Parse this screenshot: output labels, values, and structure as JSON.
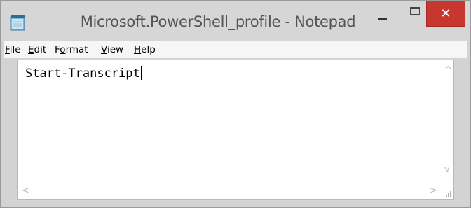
{
  "window": {
    "title": "Microsoft.PowerShell_profile - Notepad",
    "app_icon": "notepad-icon",
    "controls": {
      "minimize_icon": "minimize-icon",
      "maximize_icon": "maximize-icon",
      "close_glyph": "✕"
    }
  },
  "menu": {
    "items": [
      {
        "accel": "F",
        "rest": "ile"
      },
      {
        "accel": "E",
        "rest": "dit"
      },
      {
        "pre": "F",
        "accel": "o",
        "rest": "rmat"
      },
      {
        "accel": "V",
        "rest": "iew"
      },
      {
        "accel": "H",
        "rest": "elp"
      }
    ]
  },
  "editor": {
    "text": "Start-Transcript"
  },
  "scrollbars": {
    "up_glyph": "^",
    "down_glyph": "v",
    "left_glyph": "<",
    "right_glyph": ">"
  },
  "colors": {
    "close_button": "#c7372f",
    "titlebar": "#d6d6d6",
    "menubar": "#f5f6f7"
  }
}
